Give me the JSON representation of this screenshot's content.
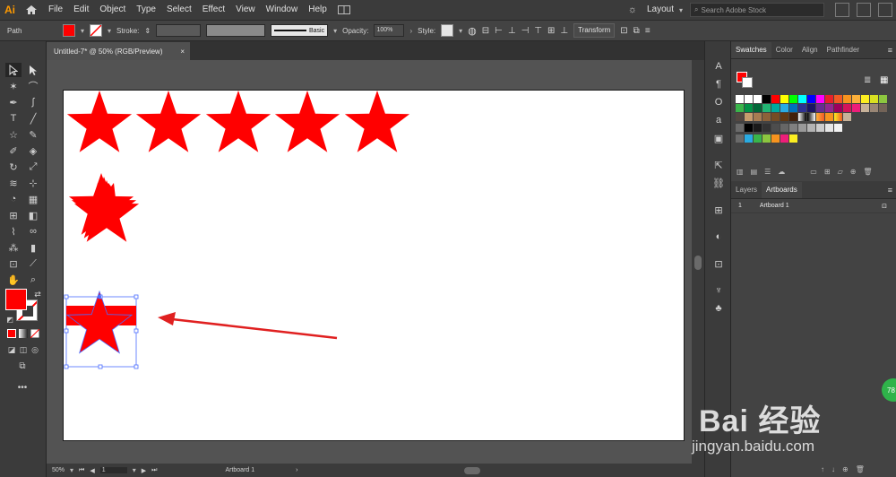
{
  "app": {
    "logo": "Ai"
  },
  "menu": [
    "File",
    "Edit",
    "Object",
    "Type",
    "Select",
    "Effect",
    "View",
    "Window",
    "Help"
  ],
  "header_right": {
    "layout_label": "Layout",
    "search_placeholder": "Search Adobe Stock"
  },
  "control_bar": {
    "selection_type": "Path",
    "fill_color": "#ff0000",
    "stroke_label": "Stroke:",
    "brush_label": "Basic",
    "opacity_label": "Opacity:",
    "opacity_value": "100%",
    "style_label": "Style:",
    "transform_label": "Transform"
  },
  "document": {
    "tab_title": "Untitled-7* @ 50% (RGB/Preview)",
    "close_glyph": "×"
  },
  "status_bar": {
    "zoom": "50%",
    "page": "1",
    "artboard_name": "Artboard 1"
  },
  "panels": {
    "top_tabs": [
      "Swatches",
      "Color",
      "Align",
      "Pathfinder"
    ],
    "bottom_tabs": [
      "Layers",
      "Artboards"
    ],
    "artboards": [
      {
        "index": "1",
        "name": "Artboard 1"
      }
    ]
  },
  "colors": {
    "accent_red": "#ff0000",
    "arrow_red": "#e02020",
    "selection_blue": "#4a6cff"
  },
  "watermark": {
    "title": "Bai 经验",
    "url": "jingyan.baidu.com",
    "badge": "78"
  }
}
